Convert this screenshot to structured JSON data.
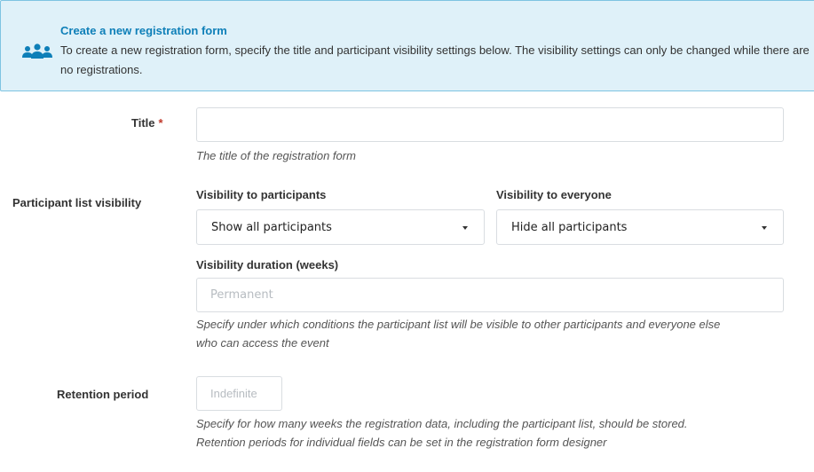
{
  "info": {
    "title": "Create a new registration form",
    "text": "To create a new registration form, specify the title and participant visibility settings below. The visibility settings can only be changed while there are no registrations.",
    "icon": "users-icon",
    "color": "#0e7fb8"
  },
  "title_field": {
    "label": "Title",
    "required_mark": "*",
    "value": "",
    "help": "The title of the registration form"
  },
  "visibility": {
    "label": "Participant list visibility",
    "participants_label": "Visibility to participants",
    "participants_value": "Show all participants",
    "everyone_label": "Visibility to everyone",
    "everyone_value": "Hide all participants",
    "duration_label": "Visibility duration (weeks)",
    "duration_placeholder": "Permanent",
    "help": "Specify under which conditions the participant list will be visible to other participants and everyone else who can access the event"
  },
  "retention": {
    "label": "Retention period",
    "placeholder": "Indefinite",
    "help": "Specify for how many weeks the registration data, including the participant list, should be stored. Retention periods for individual fields can be set in the registration form designer"
  }
}
